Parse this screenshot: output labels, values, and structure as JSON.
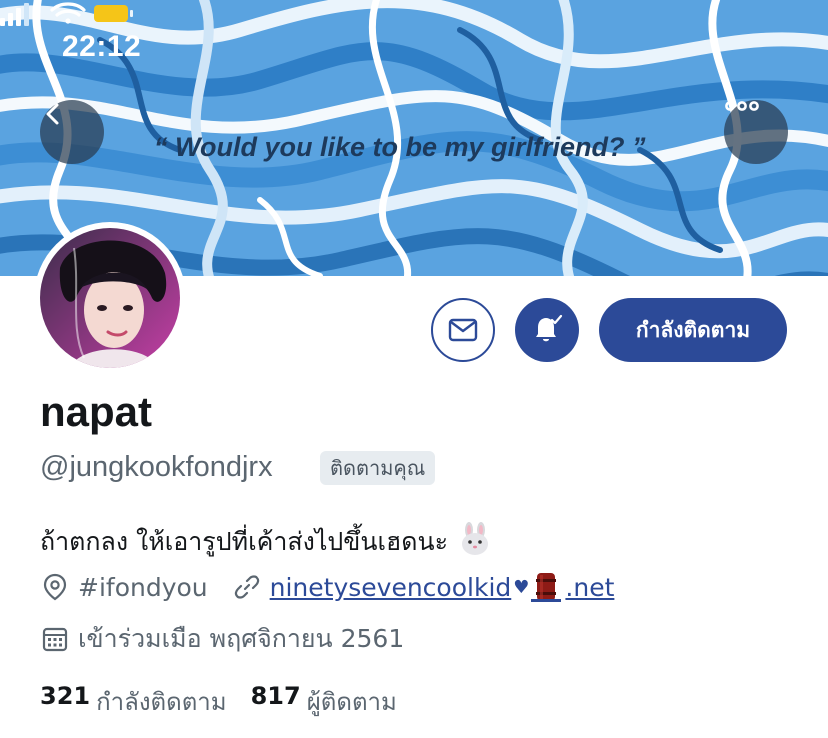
{
  "status_bar": {
    "time": "22:12",
    "icons": [
      "signal-bars-icon",
      "wifi-icon",
      "battery-icon"
    ],
    "battery_color": "#f5c518"
  },
  "header": {
    "quote": "“ Would you like to be my girlfriend? ”",
    "back_icon": "chevron-left-icon",
    "more_icon": "more-horizontal-icon"
  },
  "actions": {
    "message_icon": "envelope-icon",
    "notify_icon": "bell-check-icon",
    "follow_label": "กำลังติดตาม"
  },
  "profile": {
    "name": "napat",
    "handle": "@jungkookfondjrx",
    "follows_you": "ติดตามคุณ",
    "bio": "ถ้าตกลง ให้เอารูปที่เค้าส่งไปขึ้นเฮดนะ",
    "bio_emoji": "🐰",
    "location": "#ifondyou",
    "website_text": "ninetysevencoolkid",
    "website_heart": "♥",
    "website_tld": ".net",
    "joined": "เข้าร่วมเมือ พฤศจิกายน 2561"
  },
  "stats": {
    "following_count": "321",
    "following_label": "กำลังติดตาม",
    "followers_count": "817",
    "followers_label": "ผู้ติดตาม"
  },
  "colors": {
    "accent": "#2c4a98",
    "secondary_text": "#5b6670",
    "banner_blue": "#5aa3e0"
  }
}
